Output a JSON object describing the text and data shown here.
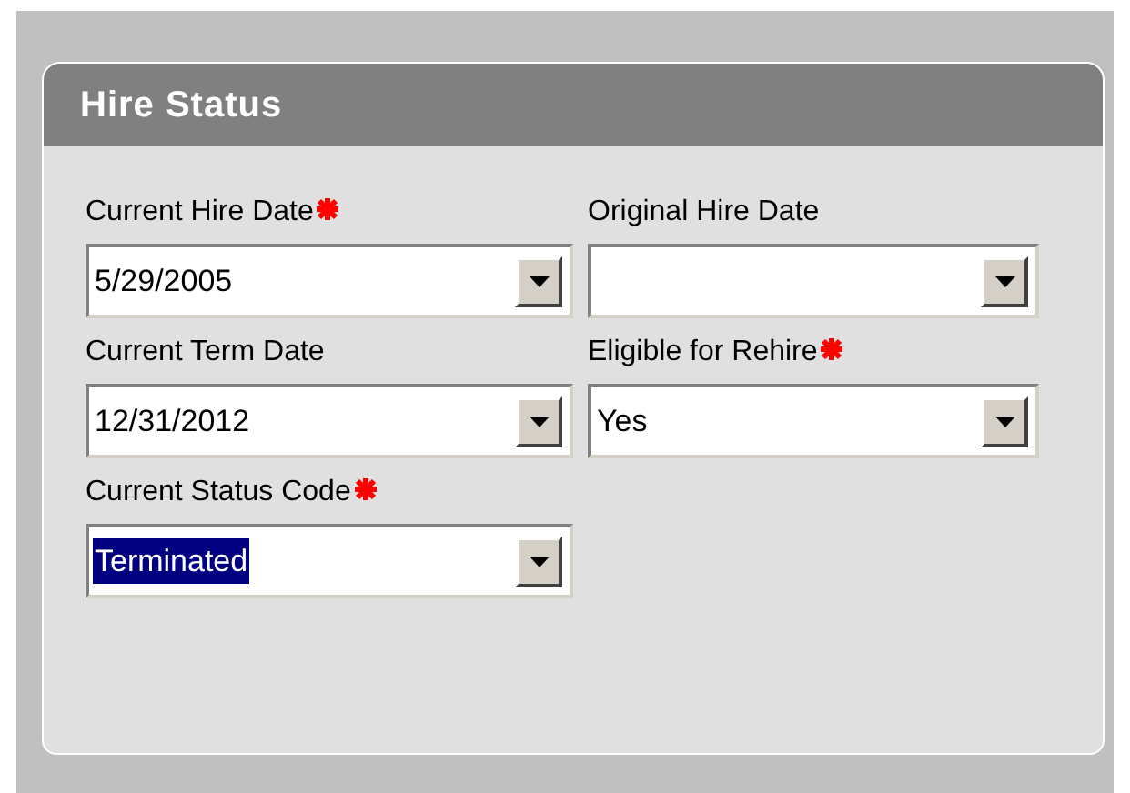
{
  "panel": {
    "title": "Hire Status"
  },
  "fields": [
    {
      "label": "Current Hire Date",
      "required": true,
      "value": "5/29/2005",
      "text_selected": false
    },
    {
      "label": "Original Hire Date",
      "required": false
    },
    {
      "label": "Current Term Date",
      "required": false,
      "value": "12/31/2012",
      "text_selected": false
    },
    {
      "label": "Eligible for Rehire",
      "required": true,
      "value": "Yes",
      "text_selected": false
    },
    {
      "label": "Current Status Code",
      "required": true,
      "value": "Terminated",
      "text_selected": true
    }
  ]
}
